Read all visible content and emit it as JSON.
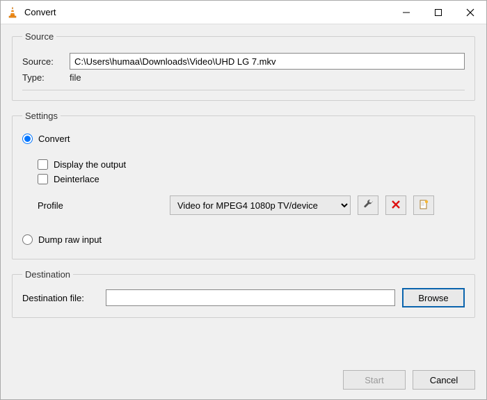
{
  "window": {
    "title": "Convert"
  },
  "source": {
    "legend": "Source",
    "source_label": "Source:",
    "source_value": "C:\\Users\\humaa\\Downloads\\Video\\UHD LG 7.mkv",
    "type_label": "Type:",
    "type_value": "file"
  },
  "settings": {
    "legend": "Settings",
    "convert_label": "Convert",
    "display_output_label": "Display the output",
    "deinterlace_label": "Deinterlace",
    "profile_label": "Profile",
    "profile_selected": "Video for MPEG4 1080p TV/device",
    "dump_raw_label": "Dump raw input"
  },
  "destination": {
    "legend": "Destination",
    "dest_label": "Destination file:",
    "dest_value": "",
    "browse_label": "Browse"
  },
  "footer": {
    "start_label": "Start",
    "cancel_label": "Cancel"
  }
}
